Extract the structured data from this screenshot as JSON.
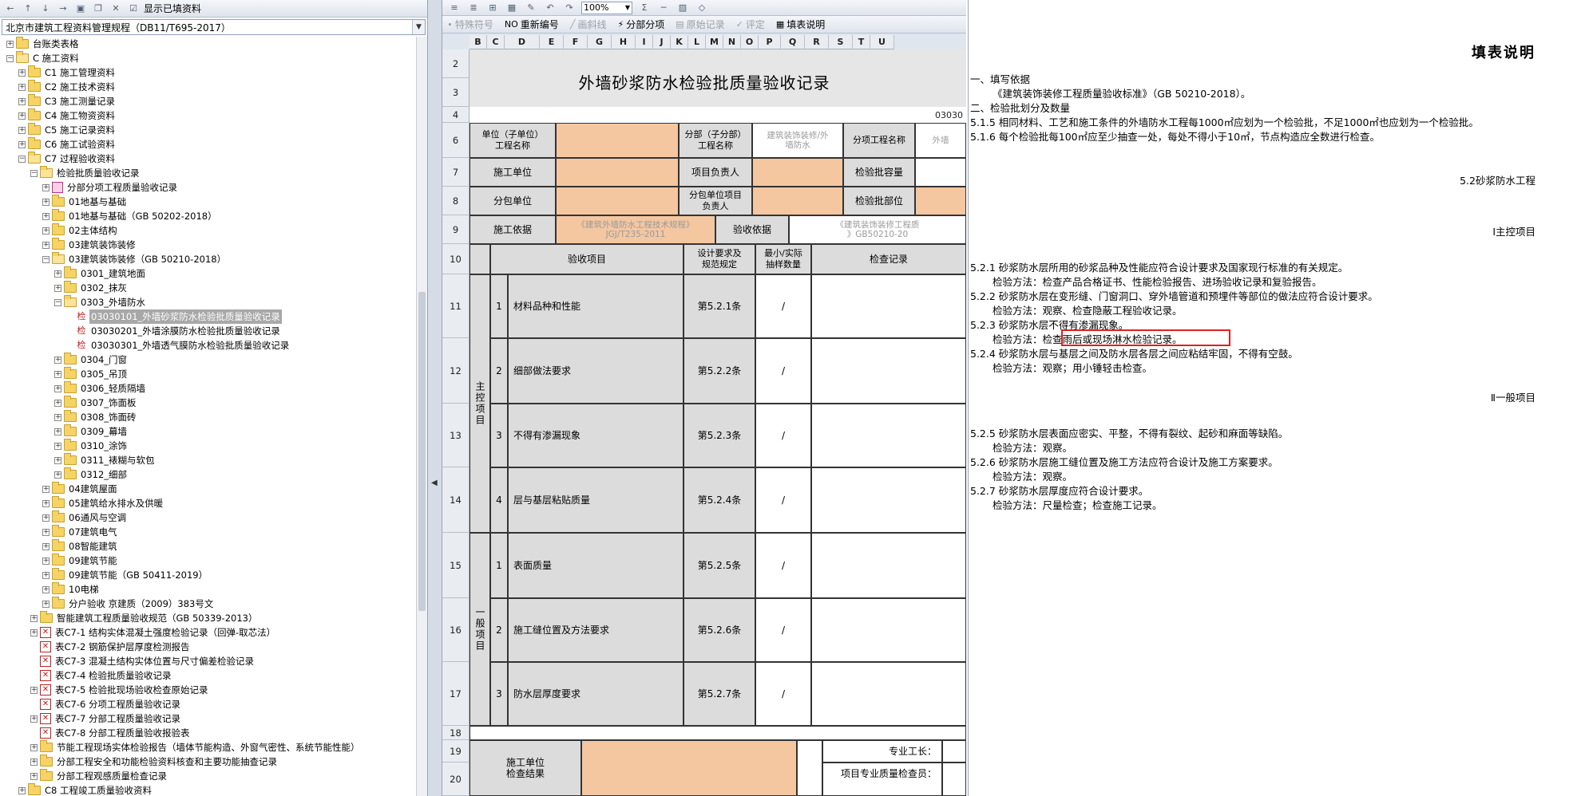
{
  "left_panel": {
    "toolbar_label": "显示已填资料",
    "combo_value": "北京市建筑工程资料管理规程（DB11/T695-2017）",
    "tree": [
      {
        "level": 0,
        "exp": "+",
        "icon": "folder",
        "label": "台账类表格"
      },
      {
        "level": 0,
        "exp": "-",
        "icon": "folder-open",
        "label": "C 施工资料"
      },
      {
        "level": 1,
        "exp": "+",
        "icon": "folder",
        "label": "C1 施工管理资料"
      },
      {
        "level": 1,
        "exp": "+",
        "icon": "folder",
        "label": "C2 施工技术资料"
      },
      {
        "level": 1,
        "exp": "+",
        "icon": "folder",
        "label": "C3 施工测量记录"
      },
      {
        "level": 1,
        "exp": "+",
        "icon": "folder",
        "label": "C4 施工物资资料"
      },
      {
        "level": 1,
        "exp": "+",
        "icon": "folder",
        "label": "C5 施工记录资料"
      },
      {
        "level": 1,
        "exp": "+",
        "icon": "folder",
        "label": "C6 施工试验资料"
      },
      {
        "level": 1,
        "exp": "-",
        "icon": "folder-open",
        "label": "C7 过程验收资料"
      },
      {
        "level": 2,
        "exp": "-",
        "icon": "folder-open",
        "label": "检验批质量验收记录"
      },
      {
        "level": 3,
        "exp": "+",
        "icon": "multi",
        "label": "分部分项工程质量验收记录"
      },
      {
        "level": 3,
        "exp": "+",
        "icon": "folder",
        "label": "01地基与基础"
      },
      {
        "level": 3,
        "exp": "+",
        "icon": "folder",
        "label": "01地基与基础（GB 50202-2018）"
      },
      {
        "level": 3,
        "exp": "+",
        "icon": "folder",
        "label": "02主体结构"
      },
      {
        "level": 3,
        "exp": "+",
        "icon": "folder",
        "label": "03建筑装饰装修"
      },
      {
        "level": 3,
        "exp": "-",
        "icon": "folder-open",
        "label": "03建筑装饰装修（GB 50210-2018）"
      },
      {
        "level": 4,
        "exp": "+",
        "icon": "folder",
        "label": "0301_建筑地面"
      },
      {
        "level": 4,
        "exp": "+",
        "icon": "folder",
        "label": "0302_抹灰"
      },
      {
        "level": 4,
        "exp": "-",
        "icon": "folder-open",
        "label": "0303_外墙防水"
      },
      {
        "level": 5,
        "exp": "",
        "icon": "jian",
        "label": "03030101_外墙砂浆防水检验批质量验收记录",
        "selected": true
      },
      {
        "level": 5,
        "exp": "",
        "icon": "jian",
        "label": "03030201_外墙涂膜防水检验批质量验收记录"
      },
      {
        "level": 5,
        "exp": "",
        "icon": "jian",
        "label": "03030301_外墙透气膜防水检验批质量验收记录"
      },
      {
        "level": 4,
        "exp": "+",
        "icon": "folder",
        "label": "0304_门窗"
      },
      {
        "level": 4,
        "exp": "+",
        "icon": "folder",
        "label": "0305_吊顶"
      },
      {
        "level": 4,
        "exp": "+",
        "icon": "folder",
        "label": "0306_轻质隔墙"
      },
      {
        "level": 4,
        "exp": "+",
        "icon": "folder",
        "label": "0307_饰面板"
      },
      {
        "level": 4,
        "exp": "+",
        "icon": "folder",
        "label": "0308_饰面砖"
      },
      {
        "level": 4,
        "exp": "+",
        "icon": "folder",
        "label": "0309_幕墙"
      },
      {
        "level": 4,
        "exp": "+",
        "icon": "folder",
        "label": "0310_涂饰"
      },
      {
        "level": 4,
        "exp": "+",
        "icon": "folder",
        "label": "0311_裱糊与软包"
      },
      {
        "level": 4,
        "exp": "+",
        "icon": "folder",
        "label": "0312_细部"
      },
      {
        "level": 3,
        "exp": "+",
        "icon": "folder",
        "label": "04建筑屋面"
      },
      {
        "level": 3,
        "exp": "+",
        "icon": "folder",
        "label": "05建筑给水排水及供暖"
      },
      {
        "level": 3,
        "exp": "+",
        "icon": "folder",
        "label": "06通风与空调"
      },
      {
        "level": 3,
        "exp": "+",
        "icon": "folder",
        "label": "07建筑电气"
      },
      {
        "level": 3,
        "exp": "+",
        "icon": "folder",
        "label": "08智能建筑"
      },
      {
        "level": 3,
        "exp": "+",
        "icon": "folder",
        "label": "09建筑节能"
      },
      {
        "level": 3,
        "exp": "+",
        "icon": "folder",
        "label": "09建筑节能（GB 50411-2019）"
      },
      {
        "level": 3,
        "exp": "+",
        "icon": "folder",
        "label": "10电梯"
      },
      {
        "level": 3,
        "exp": "+",
        "icon": "folder",
        "label": "分户验收 京建质（2009）383号文"
      },
      {
        "level": 2,
        "exp": "+",
        "icon": "folder",
        "label": "智能建筑工程质量验收规范（GB 50339-2013）"
      },
      {
        "level": 2,
        "exp": "+",
        "icon": "doc",
        "label": "表C7-1 结构实体混凝土强度检验记录（回弹-取芯法）"
      },
      {
        "level": 2,
        "exp": "",
        "icon": "doc",
        "label": "表C7-2 钢筋保护层厚度检测报告"
      },
      {
        "level": 2,
        "exp": "",
        "icon": "doc",
        "label": "表C7-3 混凝土结构实体位置与尺寸偏差检验记录"
      },
      {
        "level": 2,
        "exp": "",
        "icon": "doc",
        "label": "表C7-4 检验批质量验收记录"
      },
      {
        "level": 2,
        "exp": "+",
        "icon": "doc",
        "label": "表C7-5 检验批现场验收检查原始记录"
      },
      {
        "level": 2,
        "exp": "",
        "icon": "doc",
        "label": "表C7-6 分项工程质量验收记录"
      },
      {
        "level": 2,
        "exp": "+",
        "icon": "doc",
        "label": "表C7-7 分部工程质量验收记录"
      },
      {
        "level": 2,
        "exp": "",
        "icon": "doc",
        "label": "表C7-8 分部工程质量验收报验表"
      },
      {
        "level": 2,
        "exp": "+",
        "icon": "folder",
        "label": "节能工程现场实体检验报告（墙体节能构造、外窗气密性、系统节能性能）"
      },
      {
        "level": 2,
        "exp": "+",
        "icon": "folder",
        "label": "分部工程安全和功能检验资料核查和主要功能抽查记录"
      },
      {
        "level": 2,
        "exp": "+",
        "icon": "folder",
        "label": "分部工程观感质量检查记录"
      },
      {
        "level": 1,
        "exp": "+",
        "icon": "folder",
        "label": "C8 工程竣工质量验收资料"
      }
    ]
  },
  "mid_panel": {
    "zoom": "100%",
    "toolbar2": [
      {
        "label": "特殊符号",
        "disabled": true,
        "icon": "∙"
      },
      {
        "label": "重新编号",
        "disabled": false,
        "icon": "NO"
      },
      {
        "label": "画斜线",
        "disabled": true,
        "icon": "╱"
      },
      {
        "label": "分部分项",
        "disabled": false,
        "icon": "⚡"
      },
      {
        "label": "原始记录",
        "disabled": true,
        "icon": "▤"
      },
      {
        "label": "评定",
        "disabled": true,
        "icon": "✓"
      },
      {
        "label": "填表说明",
        "disabled": false,
        "icon": "▦"
      }
    ],
    "col_headers": [
      "B",
      "C",
      "D",
      "E",
      "F",
      "G",
      "H",
      "I",
      "J",
      "K",
      "L",
      "M",
      "N",
      "O",
      "P",
      "Q",
      "R",
      "S",
      "T",
      "U"
    ],
    "row_headers": [
      "2",
      "3",
      "4",
      "6",
      "7",
      "8",
      "9",
      "10",
      "11",
      "12",
      "13",
      "14",
      "15",
      "16",
      "17",
      "18",
      "19",
      "20"
    ],
    "form": {
      "title": "外墙砂浆防水检验批质量验收记录",
      "code": "03030",
      "r6": [
        "单位（子单位）\n工程名称",
        "分部（子分部）\n工程名称",
        "建筑装饰装修/外\n墙防水",
        "分项工程名称",
        "外墙"
      ],
      "r7": [
        "施工单位",
        "项目负责人",
        "检验批容量"
      ],
      "r8": [
        "分包单位",
        "分包单位项目\n负责人",
        "检验批部位"
      ],
      "r9": [
        "施工依据",
        "《建筑外墙防水工程技术规程》\nJGJ/T235-2011",
        "验收依据",
        "《建筑装饰装修工程质\n》GB50210-20"
      ],
      "r10": [
        "验收项目",
        "设计要求及\n规范规定",
        "最小/实际\n抽样数量",
        "检查记录"
      ],
      "main_label": "主控项目",
      "general_label": "一般项目",
      "main_items": [
        {
          "no": "1",
          "name": "材料品种和性能",
          "clause": "第5.2.1条",
          "sample": "/"
        },
        {
          "no": "2",
          "name": "细部做法要求",
          "clause": "第5.2.2条",
          "sample": "/"
        },
        {
          "no": "3",
          "name": "不得有渗漏现象",
          "clause": "第5.2.3条",
          "sample": "/"
        },
        {
          "no": "4",
          "name": "层与基层粘贴质量",
          "clause": "第5.2.4条",
          "sample": "/"
        }
      ],
      "general_items": [
        {
          "no": "1",
          "name": "表面质量",
          "clause": "第5.2.5条",
          "sample": "/"
        },
        {
          "no": "2",
          "name": "施工缝位置及方法要求",
          "clause": "第5.2.6条",
          "sample": "/"
        },
        {
          "no": "3",
          "name": "防水层厚度要求",
          "clause": "第5.2.7条",
          "sample": "/"
        }
      ],
      "result_label": "施工单位\n检查结果",
      "foreman": "专业工长：",
      "inspector": "项目专业质量检查员："
    }
  },
  "right_panel": {
    "title": "填表说明",
    "lines": [
      {
        "text": "一、填写依据",
        "indent": false
      },
      {
        "text": "《建筑装饰装修工程质量验收标准》（GB 50210-2018）。",
        "indent": true
      },
      {
        "text": "二、检验批划分及数量",
        "indent": false
      },
      {
        "text": "5.1.5 相同材料、工艺和施工条件的外墙防水工程每1000㎡应划为一个检验批，不足1000㎡也应划为一个检验批。",
        "indent": false
      },
      {
        "text": "5.1.6 每个检验批每100㎡应至少抽查一处，每处不得小于10㎡，节点构造应全数进行检查。",
        "indent": false
      }
    ],
    "section": "5.2砂浆防水工程",
    "main_heading": "Ⅰ主控项目",
    "main_lines": [
      {
        "text": "5.2.1 砂浆防水层所用的砂浆品种及性能应符合设计要求及国家现行标准的有关规定。",
        "indent": false
      },
      {
        "text": "检验方法：检查产品合格证书、性能检验报告、进场验收记录和复验报告。",
        "indent": true
      },
      {
        "text": "5.2.2 砂浆防水层在变形缝、门窗洞口、穿外墙管道和预埋件等部位的做法应符合设计要求。",
        "indent": false
      },
      {
        "text": "检验方法：观察、检查隐蔽工程验收记录。",
        "indent": true
      },
      {
        "text": "5.2.3 砂浆防水层不得有渗漏现象。",
        "indent": false
      },
      {
        "text": "检验方法：检查雨后或现场淋水检验记录。",
        "indent": true
      },
      {
        "text": "5.2.4 砂浆防水层与基层之间及防水层各层之间应粘结牢固，不得有空鼓。",
        "indent": false
      },
      {
        "text": "检验方法：观察；用小锤轻击检查。",
        "indent": true
      }
    ],
    "general_heading": "Ⅱ一般项目",
    "general_lines": [
      {
        "text": "5.2.5 砂浆防水层表面应密实、平整，不得有裂纹、起砂和麻面等缺陷。",
        "indent": false
      },
      {
        "text": "检验方法：观察。",
        "indent": true
      },
      {
        "text": "5.2.6 砂浆防水层施工缝位置及施工方法应符合设计及施工方案要求。",
        "indent": false
      },
      {
        "text": "检验方法：观察。",
        "indent": true
      },
      {
        "text": "5.2.7 砂浆防水层厚度应符合设计要求。",
        "indent": false
      },
      {
        "text": "检验方法：尺量检查；检查施工记录。",
        "indent": true
      }
    ],
    "highlight_color": "#e02020"
  },
  "colors": {
    "orange_cell": "#f4c7a1",
    "gray_cell": "#dcdcdc",
    "selected_row": "#a8a8a8"
  }
}
